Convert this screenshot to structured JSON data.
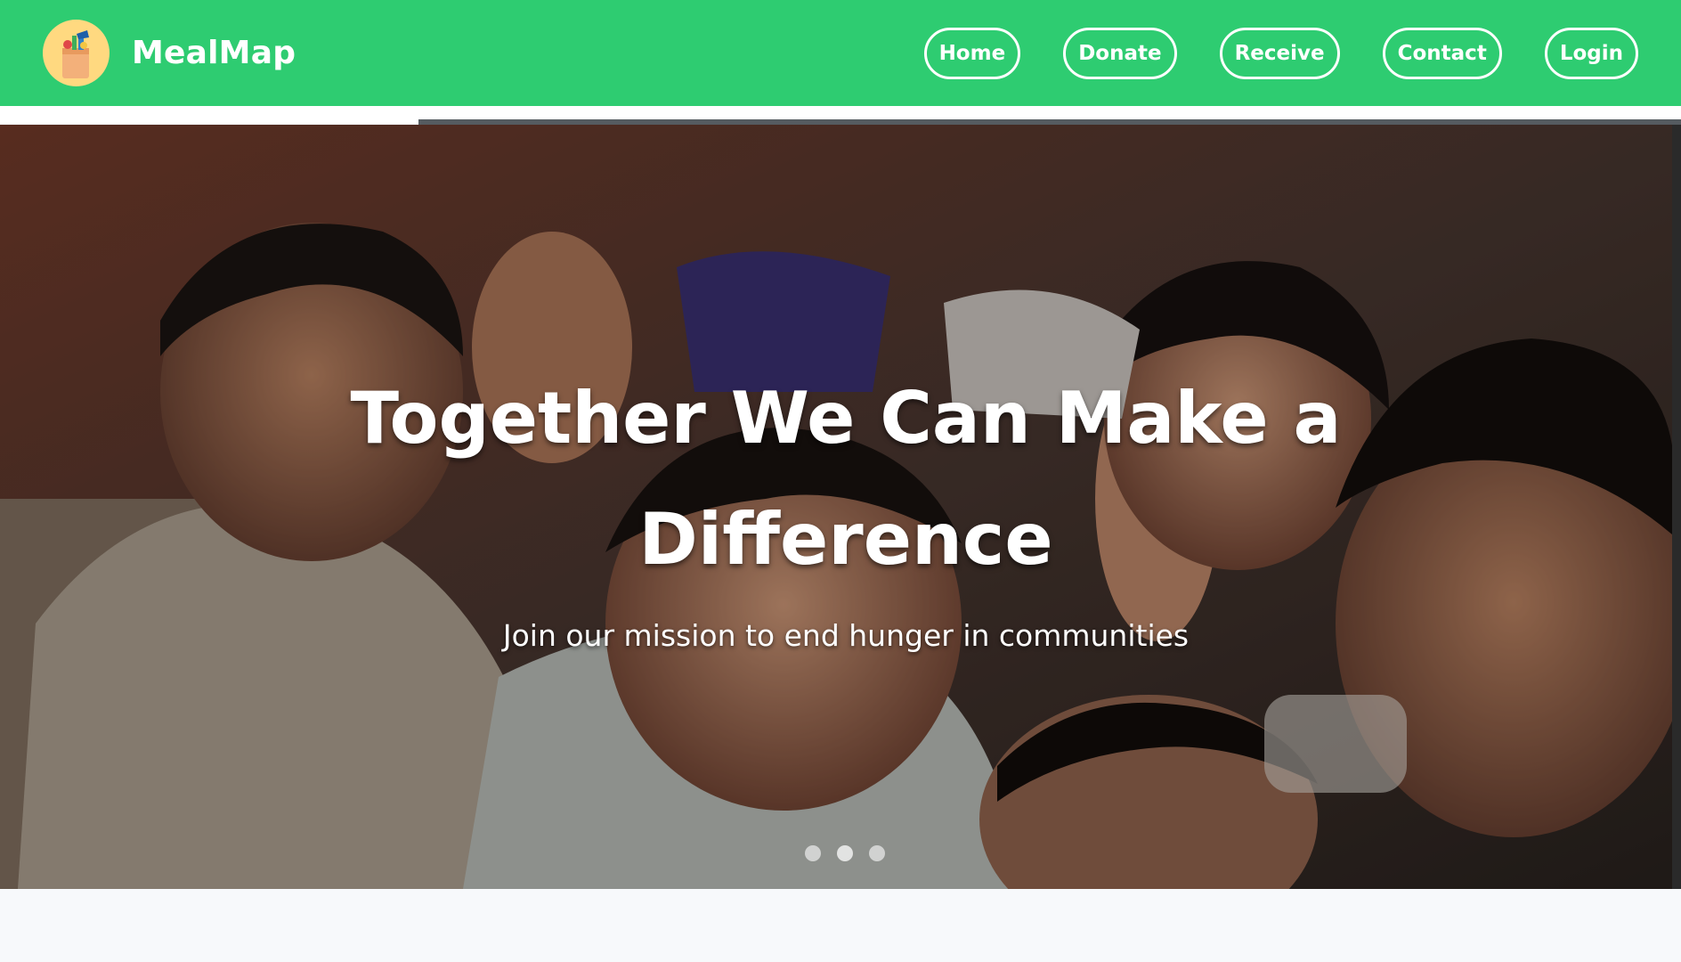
{
  "brand": {
    "name": "MealMap",
    "logo_icon": "grocery-bag-icon",
    "primary_color": "#2ecc71"
  },
  "nav": {
    "items": [
      {
        "label": "Home"
      },
      {
        "label": "Donate"
      },
      {
        "label": "Receive"
      },
      {
        "label": "Contact"
      },
      {
        "label": "Login"
      }
    ]
  },
  "hero": {
    "title": "Together We Can Make a Difference",
    "subtitle": "Join our mission to end hunger in communities",
    "slides_total": 3,
    "active_slide": 2
  }
}
